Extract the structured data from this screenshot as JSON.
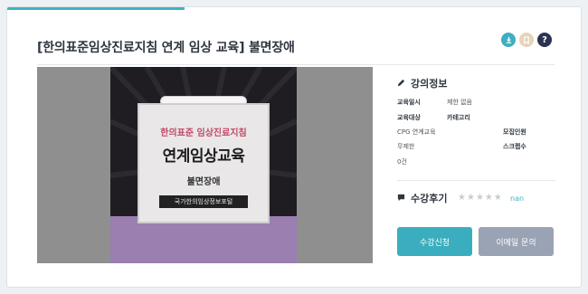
{
  "header": {
    "title": "[한의표준임상진료지침 연계 임상 교육] 불면장애",
    "icons": [
      "download-icon",
      "bookmark-icon",
      "help-icon"
    ],
    "help_glyph": "?"
  },
  "thumbnail": {
    "line1": "한의표준 임상진료지침",
    "line2": "연계임상교육",
    "line3": "불면장애",
    "badge": "국가한의임상정보포털"
  },
  "lecture_info": {
    "section_title": "강의정보",
    "education_date_label": "교육일시",
    "education_date_value": "제한 없음",
    "target_label": "교육대상",
    "category_label": "카테고리",
    "target_value": "CPG 연계교육",
    "recruit_label": "모집인원",
    "recruit_value": "무제한",
    "scrap_label": "스크랩수",
    "scrap_value": "0건"
  },
  "review": {
    "section_title": "수강후기",
    "rating_text": "nan",
    "stars_filled": 0,
    "stars_total": 5
  },
  "actions": {
    "apply_label": "수강신청",
    "email_label": "이메일 문의"
  },
  "colors": {
    "accent": "#3fb3c0",
    "apply_button": "#3aaebf",
    "email_button": "#9aa3b3",
    "help_icon": "#2b3350",
    "bookmark_icon": "#e6d3b8"
  }
}
